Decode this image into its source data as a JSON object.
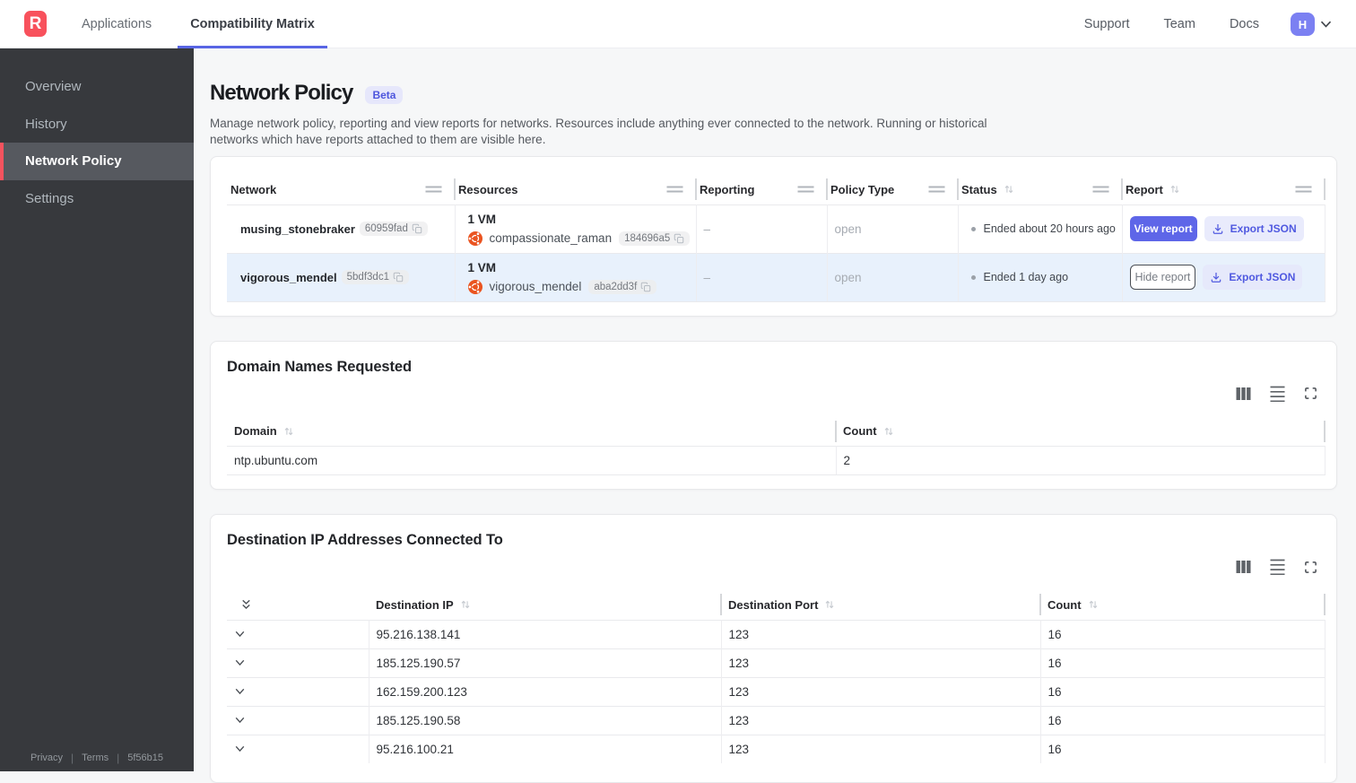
{
  "topbar": {
    "logo_letter": "R",
    "tabs": [
      {
        "label": "Applications",
        "active": false
      },
      {
        "label": "Compatibility Matrix",
        "active": true
      }
    ],
    "links": [
      "Support",
      "Team",
      "Docs"
    ],
    "avatar_initial": "H"
  },
  "sidebar": {
    "items": [
      {
        "label": "Overview",
        "active": false
      },
      {
        "label": "History",
        "active": false
      },
      {
        "label": "Network Policy",
        "active": true
      },
      {
        "label": "Settings",
        "active": false
      }
    ],
    "footer": {
      "privacy": "Privacy",
      "terms": "Terms",
      "build": "5f56b15"
    }
  },
  "page": {
    "title": "Network Policy",
    "badge": "Beta",
    "description_line1": "Manage network policy, reporting and view reports for networks. Resources include anything ever connected to the network. Running or historical",
    "description_line2": "networks which have reports attached to them are visible here."
  },
  "networks_table": {
    "columns": {
      "network": "Network",
      "resources": "Resources",
      "reporting": "Reporting",
      "policy_type": "Policy Type",
      "status": "Status",
      "report": "Report"
    },
    "rows": [
      {
        "network": "musing_stonebraker",
        "network_id": "60959fad",
        "vm_count": "1 VM",
        "resource_name": "compassionate_raman",
        "resource_id": "184696a5",
        "reporting": "–",
        "policy_type": "open",
        "status": "Ended about 20 hours ago",
        "report_button": "View report",
        "export_button": "Export JSON"
      },
      {
        "network": "vigorous_mendel",
        "network_id": "5bdf3dc1",
        "vm_count": "1 VM",
        "resource_name": "vigorous_mendel",
        "resource_id": "aba2dd3f",
        "reporting": "–",
        "policy_type": "open",
        "status": "Ended 1 day ago",
        "report_button": "Hide report",
        "export_button": "Export JSON"
      }
    ]
  },
  "domains_card": {
    "title": "Domain Names Requested",
    "columns": {
      "domain": "Domain",
      "count": "Count"
    },
    "rows": [
      {
        "domain": "ntp.ubuntu.com",
        "count": "2"
      }
    ]
  },
  "ips_card": {
    "title": "Destination IP Addresses Connected To",
    "columns": {
      "ip": "Destination IP",
      "port": "Destination Port",
      "count": "Count"
    },
    "rows": [
      {
        "ip": "95.216.138.141",
        "port": "123",
        "count": "16"
      },
      {
        "ip": "185.125.190.57",
        "port": "123",
        "count": "16"
      },
      {
        "ip": "162.159.200.123",
        "port": "123",
        "count": "16"
      },
      {
        "ip": "185.125.190.58",
        "port": "123",
        "count": "16"
      },
      {
        "ip": "95.216.100.21",
        "port": "123",
        "count": "16"
      }
    ]
  }
}
